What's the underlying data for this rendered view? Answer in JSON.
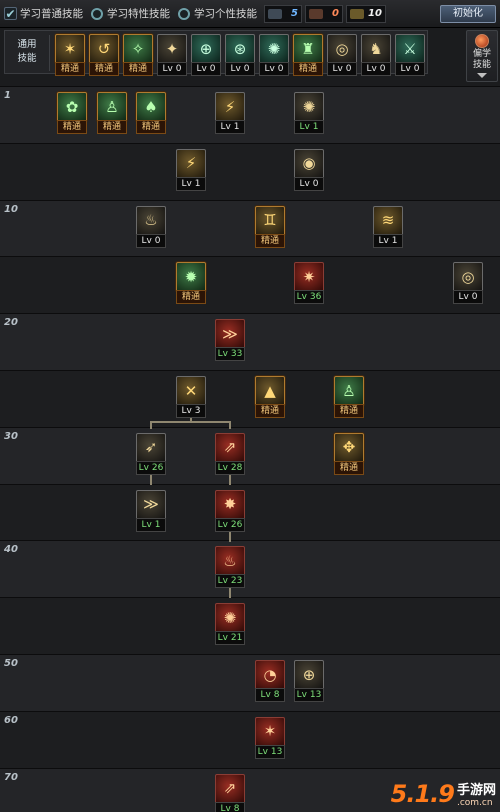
{
  "tabs": [
    {
      "label": "学习普通技能",
      "kind": "check"
    },
    {
      "label": "学习特性技能",
      "kind": "radio"
    },
    {
      "label": "学习个性技能",
      "kind": "radio"
    }
  ],
  "counters": [
    {
      "icon": "sp-icon",
      "value": "5",
      "color": "#6fb6ff"
    },
    {
      "icon": "tp-icon",
      "value": "0",
      "color": "#ff8a5a"
    },
    {
      "icon": "qp-icon",
      "value": "10",
      "color": "#f0f0f0"
    }
  ],
  "reset_button": "初始化",
  "common": {
    "label": "通用\n技能",
    "skills": [
      {
        "name": "common-skill-1",
        "tag": "精通",
        "style": "gold",
        "glyph": "✶"
      },
      {
        "name": "common-skill-2",
        "tag": "精通",
        "style": "gold",
        "glyph": "↺"
      },
      {
        "name": "common-skill-3",
        "tag": "精通",
        "style": "green",
        "glyph": "✧"
      },
      {
        "name": "common-skill-4",
        "tag": "Lv 0",
        "style": "dark",
        "glyph": "✦"
      },
      {
        "name": "common-skill-5",
        "tag": "Lv 0",
        "style": "teal",
        "glyph": "⊕"
      },
      {
        "name": "common-skill-6",
        "tag": "Lv 0",
        "style": "teal",
        "glyph": "⊛"
      },
      {
        "name": "common-skill-7",
        "tag": "Lv 0",
        "style": "teal",
        "glyph": "✺"
      },
      {
        "name": "common-skill-8",
        "tag": "精通",
        "style": "green",
        "glyph": "♜"
      },
      {
        "name": "common-skill-9",
        "tag": "Lv 0",
        "style": "dark",
        "glyph": "◎"
      },
      {
        "name": "common-skill-10",
        "tag": "Lv 0",
        "style": "dark",
        "glyph": "♞"
      },
      {
        "name": "common-skill-11",
        "tag": "Lv 0",
        "style": "teal",
        "glyph": "⚔"
      }
    ]
  },
  "side_tab": {
    "label": "偏学\n技能"
  },
  "level_labels": [
    "1",
    "10",
    "20",
    "30",
    "40",
    "50",
    "60",
    "70"
  ],
  "tree_skills": [
    {
      "row": 0,
      "col": 57,
      "tag": "精通",
      "style": "green",
      "glyph": "✿"
    },
    {
      "row": 0,
      "col": 97,
      "tag": "精通",
      "style": "green",
      "glyph": "♙"
    },
    {
      "row": 0,
      "col": 136,
      "tag": "精通",
      "style": "green",
      "glyph": "♠"
    },
    {
      "row": 0,
      "col": 215,
      "tag": "Lv 1",
      "style": "gold",
      "glyph": "⚡"
    },
    {
      "row": 0,
      "col": 294,
      "tag": "Lv 1",
      "style": "dark",
      "glyph": "✺"
    },
    {
      "row": 1,
      "col": 176,
      "tag": "Lv 1",
      "style": "gold",
      "glyph": "⚡"
    },
    {
      "row": 1,
      "col": 294,
      "tag": "Lv 0",
      "style": "dark",
      "glyph": "◉"
    },
    {
      "row": 2,
      "col": 136,
      "tag": "Lv 0",
      "style": "dark",
      "glyph": "♨"
    },
    {
      "row": 2,
      "col": 255,
      "tag": "精通",
      "style": "gold",
      "glyph": "♊"
    },
    {
      "row": 2,
      "col": 373,
      "tag": "Lv 1",
      "style": "gold",
      "glyph": "≋"
    },
    {
      "row": 3,
      "col": 176,
      "tag": "精通",
      "style": "green",
      "glyph": "✹"
    },
    {
      "row": 3,
      "col": 294,
      "tag": "Lv 36",
      "style": "red",
      "glyph": "✷"
    },
    {
      "row": 3,
      "col": 453,
      "tag": "Lv 0",
      "style": "dark",
      "glyph": "◎"
    },
    {
      "row": 4,
      "col": 215,
      "tag": "Lv 33",
      "style": "red",
      "glyph": "≫"
    },
    {
      "row": 5,
      "col": 176,
      "tag": "Lv 3",
      "style": "gold",
      "glyph": "✕"
    },
    {
      "row": 5,
      "col": 255,
      "tag": "精通",
      "style": "gold",
      "glyph": "▲"
    },
    {
      "row": 5,
      "col": 334,
      "tag": "精通",
      "style": "green",
      "glyph": "♙"
    },
    {
      "row": 6,
      "col": 136,
      "tag": "Lv 26",
      "style": "dark",
      "glyph": "➶"
    },
    {
      "row": 6,
      "col": 215,
      "tag": "Lv 28",
      "style": "red",
      "glyph": "⇗"
    },
    {
      "row": 6,
      "col": 334,
      "tag": "精通",
      "style": "gold",
      "glyph": "✥"
    },
    {
      "row": 7,
      "col": 136,
      "tag": "Lv 1",
      "style": "dark",
      "glyph": "≫"
    },
    {
      "row": 7,
      "col": 215,
      "tag": "Lv 26",
      "style": "red",
      "glyph": "✸"
    },
    {
      "row": 8,
      "col": 215,
      "tag": "Lv 23",
      "style": "red",
      "glyph": "♨"
    },
    {
      "row": 9,
      "col": 215,
      "tag": "Lv 21",
      "style": "red",
      "glyph": "✺"
    },
    {
      "row": 10,
      "col": 255,
      "tag": "Lv 8",
      "style": "red",
      "glyph": "◔"
    },
    {
      "row": 10,
      "col": 294,
      "tag": "Lv 13",
      "style": "dark",
      "glyph": "⊕"
    },
    {
      "row": 11,
      "col": 255,
      "tag": "Lv 13",
      "style": "red",
      "glyph": "✶"
    },
    {
      "row": 12,
      "col": 215,
      "tag": "Lv 8",
      "style": "red",
      "glyph": "⇗"
    }
  ],
  "watermark": {
    "main": "5.1.9",
    "cn": "手游网",
    "url": ".com.cn"
  }
}
